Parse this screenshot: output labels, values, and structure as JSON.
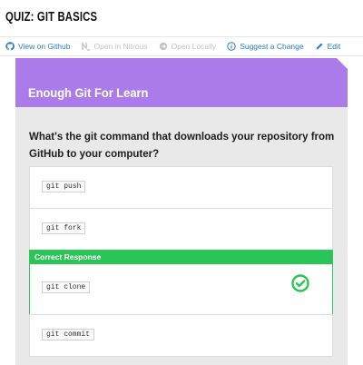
{
  "page": {
    "title": "QUIZ: GIT BASICS"
  },
  "toolbar": {
    "items": [
      {
        "label": "View on Github",
        "icon": "github-icon",
        "state": "active"
      },
      {
        "label": "Open in Nitrous",
        "icon": "nitrous-icon",
        "state": "disabled"
      },
      {
        "label": "Open Locally",
        "icon": "open-locally-icon",
        "state": "disabled"
      },
      {
        "label": "Suggest a Change",
        "icon": "info-icon",
        "state": "active"
      },
      {
        "label": "Edit",
        "icon": "pencil-icon",
        "state": "active"
      }
    ]
  },
  "card": {
    "title": "Enough Git For Learn",
    "question": "What's the git command that downloads your repository from GitHub to your computer?"
  },
  "options": [
    {
      "code": "git push"
    },
    {
      "code": "git fork"
    },
    {
      "code": "git clone",
      "banner": "Correct Response",
      "correct": true
    },
    {
      "code": "git commit"
    }
  ],
  "colors": {
    "accent_purple": "#ab7ce9",
    "correct_green": "#29c556",
    "link_blue": "#2a7fb8",
    "disabled_gray": "#c2c2c2"
  }
}
